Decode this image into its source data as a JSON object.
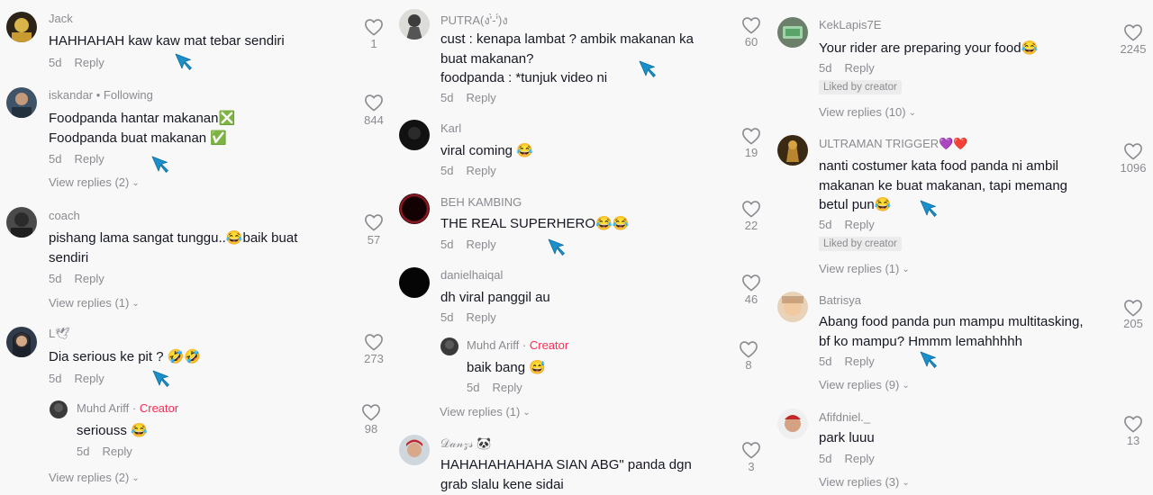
{
  "comments": {
    "jack": {
      "user": "Jack",
      "text": "HAHHAHAH kaw kaw mat tebar sendiri",
      "time": "5d",
      "reply": "Reply",
      "likes": "1"
    },
    "iskandar": {
      "user": "iskandar • Following",
      "text": "Foodpanda hantar makanan❎\nFoodpanda buat makanan ✅",
      "time": "5d",
      "reply": "Reply",
      "likes": "844",
      "view_replies": "View replies (2)"
    },
    "coach": {
      "user": "coach",
      "text": "pishang lama sangat tunggu..😂baik buat\nsendiri",
      "time": "5d",
      "reply": "Reply",
      "likes": "57",
      "view_replies": "View replies (1)"
    },
    "l": {
      "user": "L🕊",
      "text": "Dia serious ke pit ? 🤣🤣",
      "time": "5d",
      "reply": "Reply",
      "likes": "273"
    },
    "l_reply": {
      "user": "Muhd Ariff",
      "creator": "Creator",
      "text": "seriouss 😂",
      "time": "5d",
      "reply": "Reply",
      "likes": "98",
      "view_replies": "View replies (2)"
    },
    "putra": {
      "user": "PUTRA(ง'̀-'́)ง",
      "text": "cust : kenapa lambat ? ambik makanan ka\nbuat makanan?\nfoodpanda : *tunjuk video ni",
      "likes": "60",
      "time": "5d",
      "reply": "Reply"
    },
    "karl": {
      "user": "Karl",
      "text": "viral coming 😂",
      "time": "5d",
      "reply": "Reply",
      "likes": "19"
    },
    "beh": {
      "user": "BEH KAMBING",
      "text": "THE REAL SUPERHERO😂😂",
      "time": "5d",
      "reply": "Reply",
      "likes": "22"
    },
    "daniel": {
      "user": "danielhaiqal",
      "text": "dh viral panggil au",
      "time": "5d",
      "reply": "Reply",
      "likes": "46"
    },
    "daniel_reply": {
      "user": "Muhd Ariff",
      "creator": "Creator",
      "text": "baik bang 😅",
      "time": "5d",
      "reply": "Reply",
      "likes": "8",
      "view_replies": "View replies (1)"
    },
    "danzs": {
      "user": "𝒟𝒶𝓃𝓏𝓈 🐼",
      "text": "HAHAHAHAHAHA SIAN ABG\" panda dgn\ngrab slalu kene sidai",
      "likes": "3"
    },
    "keklapis": {
      "user": "KekLapis7E",
      "text": "Your rider are preparing your food😂",
      "time": "5d",
      "reply": "Reply",
      "likes": "2245",
      "liked_by": "Liked by creator",
      "view_replies": "View replies (10)"
    },
    "ultraman": {
      "user": "ULTRAMAN TRIGGER💜❤️",
      "text": "nanti costumer kata food panda ni ambil\nmakanan ke buat makanan, tapi memang\nbetul pun😂",
      "time": "5d",
      "reply": "Reply",
      "likes": "1096",
      "liked_by": "Liked by creator",
      "view_replies": "View replies (1)"
    },
    "batrisya": {
      "user": "Batrisya",
      "text": "Abang food panda pun mampu multitasking,\nbf ko mampu? Hmmm lemahhhhh",
      "time": "5d",
      "reply": "Reply",
      "likes": "205",
      "view_replies": "View replies (9)"
    },
    "afifdniel": {
      "user": "Afifdniel._",
      "text": "park luuu",
      "time": "5d",
      "reply": "Reply",
      "likes": "13",
      "view_replies": "View replies (3)"
    }
  },
  "icons": {
    "like": "heart-outline-icon",
    "cursor": "mouse-pointer-icon",
    "chevron": "chevron-down-icon"
  },
  "colors": {
    "creator": "#fe2c55",
    "muted": "#8a8b91",
    "text": "#161823",
    "cursor": "#1a8fc9"
  }
}
